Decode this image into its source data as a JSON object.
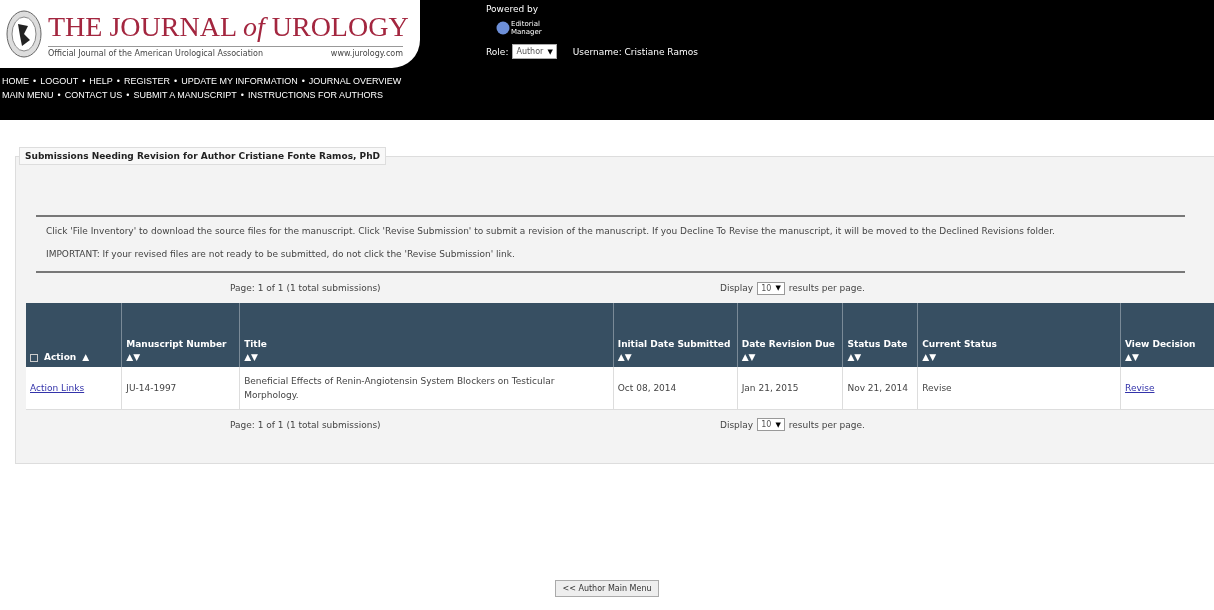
{
  "header": {
    "journal_title": "THE JOURNAL *of* UROLOGY",
    "subtitle": "Official Journal of the American Urological Association",
    "website": "www.jurology.com",
    "nav_separator": "•",
    "nav_lines": [
      [
        "HOME",
        "LOGOUT",
        "HELP",
        "REGISTER",
        "UPDATE MY INFORMATION",
        "JOURNAL OVERVIEW"
      ],
      [
        "MAIN MENU",
        "CONTACT US",
        "SUBMIT A MANUSCRIPT",
        "INSTRUCTIONS FOR AUTHORS"
      ]
    ],
    "powered_by": "Powered by",
    "em_logo_lines": [
      "Editorial",
      "Manager"
    ],
    "role_label": "Role:",
    "role_value": "Author",
    "dropdown_arrow": "▼",
    "username": "Username: Cristiane Ramos"
  },
  "panel": {
    "legend": "Submissions Needing Revision for Author Cristiane Fonte Ramos, PhD",
    "instructions": [
      "Click 'File Inventory' to download the source files for the manuscript. Click 'Revise Submission' to submit a revision of the manuscript. If you Decline To Revise the manuscript, it will be moved to the Declined Revisions folder.",
      "IMPORTANT: If your revised files are not ready to be submitted, do not click the 'Revise Submission' link."
    ],
    "pagination": [
      {
        "page_info": "Page: 1 of 1 (1 total submissions)",
        "display_label": "Display",
        "per_page": "10",
        "dropdown_arrow": "▼",
        "results_label": "results per page."
      },
      {
        "page_info": "Page: 1 of 1 (1 total submissions)",
        "display_label": "Display",
        "per_page": "10",
        "dropdown_arrow": "▼",
        "results_label": "results per page."
      }
    ],
    "table": {
      "columns": [
        {
          "label": "Action",
          "sort": "▲",
          "kind": "action"
        },
        {
          "label": "Manuscript Number",
          "sort": "▲▼",
          "kind": "plain"
        },
        {
          "label": "Title",
          "sort": "▲▼",
          "kind": "plain"
        },
        {
          "label": "Initial Date Submitted",
          "sort": "▲▼",
          "kind": "plain"
        },
        {
          "label": "Date Revision Due",
          "sort": "▲▼",
          "kind": "plain"
        },
        {
          "label": "Status Date",
          "sort": "▲▼",
          "kind": "plain"
        },
        {
          "label": "Current Status",
          "sort": "▲▼",
          "kind": "plain"
        },
        {
          "label": "View Decision",
          "sort": "▲▼",
          "kind": "plain"
        }
      ],
      "rows": [
        [
          {
            "text": "Action Links",
            "kind": "link"
          },
          {
            "text": "JU-14-1997",
            "kind": "text"
          },
          {
            "text": "Beneficial Effects of Renin-Angiotensin System Blockers on Testicular Morphology.",
            "kind": "text"
          },
          {
            "text": "Oct 08, 2014",
            "kind": "text"
          },
          {
            "text": "Jan 21, 2015",
            "kind": "text"
          },
          {
            "text": "Nov 21, 2014",
            "kind": "text"
          },
          {
            "text": "Revise",
            "kind": "text"
          },
          {
            "text": "Revise",
            "kind": "link"
          }
        ]
      ]
    }
  },
  "footer_button": "<< Author Main Menu"
}
